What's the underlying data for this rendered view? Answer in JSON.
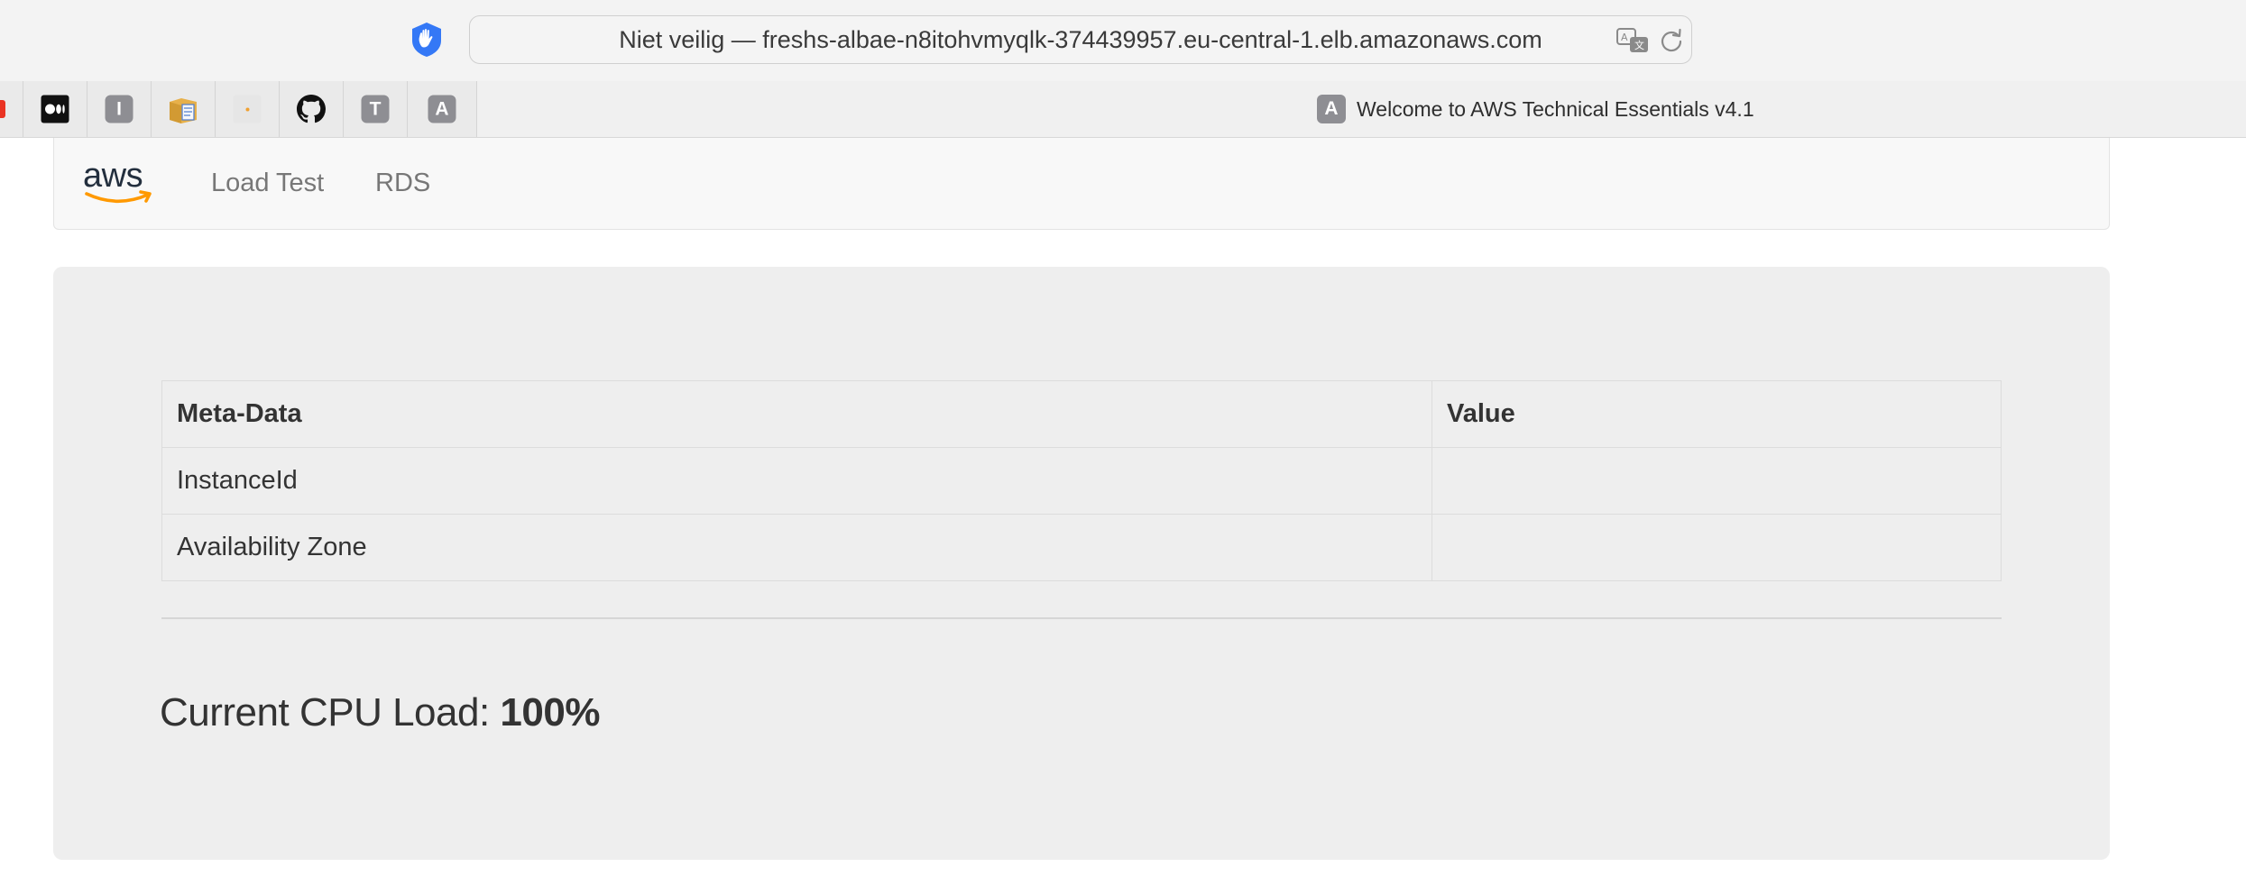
{
  "browser": {
    "address_bar": {
      "security_label": "Niet veilig",
      "separator": "—",
      "url": "freshs-albae-n8itohvmyqlk-374439957.eu-central-1.elb.amazonaws.com"
    },
    "pinned_tabs": [
      {
        "icon": "red-favicon-icon"
      },
      {
        "icon": "medium-icon"
      },
      {
        "icon": "letter-i-icon",
        "letter": "I"
      },
      {
        "icon": "notes-box-icon"
      },
      {
        "icon": "dot-icon"
      },
      {
        "icon": "github-icon"
      },
      {
        "icon": "letter-t-icon",
        "letter": "T"
      },
      {
        "icon": "letter-a-icon",
        "letter": "A"
      }
    ],
    "active_tab": {
      "favicon_letter": "A",
      "title": "Welcome to AWS Technical Essentials v4.1"
    }
  },
  "navbar": {
    "logo": "aws",
    "links": [
      {
        "label": "Load Test"
      },
      {
        "label": "RDS"
      }
    ]
  },
  "main": {
    "table": {
      "headers": [
        "Meta-Data",
        "Value"
      ],
      "rows": [
        {
          "key": "InstanceId",
          "value": ""
        },
        {
          "key": "Availability Zone",
          "value": ""
        }
      ]
    },
    "cpu": {
      "label": "Current CPU Load:",
      "value": "100%"
    }
  },
  "colors": {
    "shield_blue": "#3478f6",
    "aws_orange": "#ff9900",
    "aws_text": "#232f3e",
    "jumbotron_bg": "#eeeeee"
  }
}
